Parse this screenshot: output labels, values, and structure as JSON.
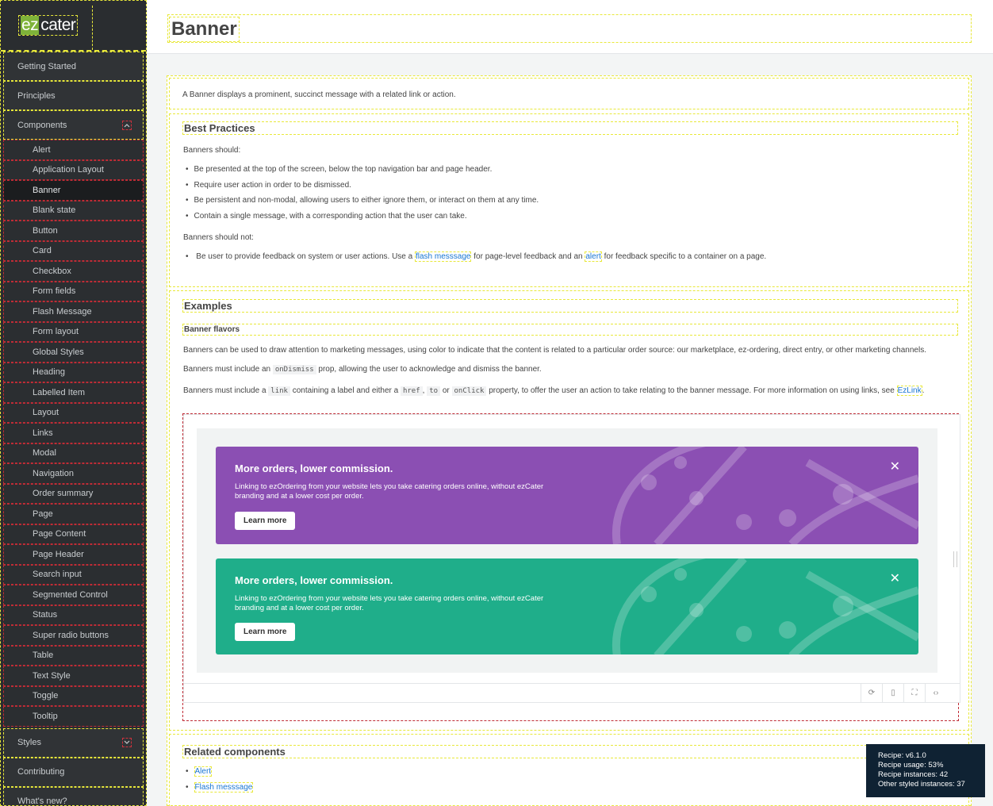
{
  "logo": {
    "part1": "ez",
    "part2": "cater"
  },
  "sidebar": {
    "top_items": [
      {
        "label": "Getting Started"
      },
      {
        "label": "Principles"
      }
    ],
    "components_label": "Components",
    "components": [
      "Alert",
      "Application Layout",
      "Banner",
      "Blank state",
      "Button",
      "Card",
      "Checkbox",
      "Form fields",
      "Flash Message",
      "Form layout",
      "Global Styles",
      "Heading",
      "Labelled Item",
      "Layout",
      "Links",
      "Modal",
      "Navigation",
      "Order summary",
      "Page",
      "Page Content",
      "Page Header",
      "Search input",
      "Segmented Control",
      "Status",
      "Super radio buttons",
      "Table",
      "Text Style",
      "Toggle",
      "Tooltip"
    ],
    "active_component": "Banner",
    "styles_label": "Styles",
    "contributing_label": "Contributing",
    "whats_new_label": "What's new?"
  },
  "header": {
    "title": "Banner"
  },
  "intro": "A Banner displays a prominent, succinct message with a related link or action.",
  "best_practices": {
    "heading": "Best Practices",
    "should_label": "Banners should:",
    "should": [
      "Be presented at the top of the screen, below the top navigation bar and page header.",
      "Require user action in order to be dismissed.",
      "Be persistent and non-modal, allowing users to either ignore them, or interact on them at any time.",
      "Contain a single message, with a corresponding action that the user can take."
    ],
    "should_not_label": "Banners should not:",
    "should_not_pre": "Be user to provide feedback on system or user actions. Use a ",
    "should_not_link1": "flash messsage",
    "should_not_mid": " for page-level feedback and an ",
    "should_not_link2": "alert",
    "should_not_post": " for feedback specific to a container on a page."
  },
  "examples": {
    "heading": "Examples",
    "subheading": "Banner flavors",
    "p1": "Banners can be used to draw attention to marketing messages, using color to indicate that the content is related to a particular order source: our marketplace, ez-ordering, direct entry, or other marketing channels.",
    "p2_pre": "Banners must include an ",
    "p2_code": "onDismiss",
    "p2_post": " prop, allowing the user to acknowledge and dismiss the banner.",
    "p3_pre": "Banners must include a ",
    "p3_code1": "link",
    "p3_mid1": " containing a label and either a ",
    "p3_code2": "href",
    "p3_sep1": ", ",
    "p3_code3": "to",
    "p3_sep2": " or ",
    "p3_code4": "onClick",
    "p3_mid2": " property, to offer the user an action to take relating to the banner message. For more information on using links, see ",
    "p3_link": "EzLink",
    "p3_end": "."
  },
  "banners": [
    {
      "title": "More orders, lower commission.",
      "body": "Linking to ezOrdering from your website lets you take catering orders online, without ezCater branding and at a lower cost per order.",
      "button": "Learn more",
      "color": "#8b4fb3"
    },
    {
      "title": "More orders, lower commission.",
      "body": "Linking to ezOrdering from your website lets you take catering orders online, without ezCater branding and at a lower cost per order.",
      "button": "Learn more",
      "color": "#1fae8a"
    }
  ],
  "related": {
    "heading": "Related components",
    "links": [
      "Alert",
      "Flash messsage"
    ]
  },
  "tooltip": {
    "line1": "Recipe: v6.1.0",
    "line2": "Recipe usage: 53%",
    "line3": "Recipe instances: 42",
    "line4": "Other styled instances: 37"
  }
}
